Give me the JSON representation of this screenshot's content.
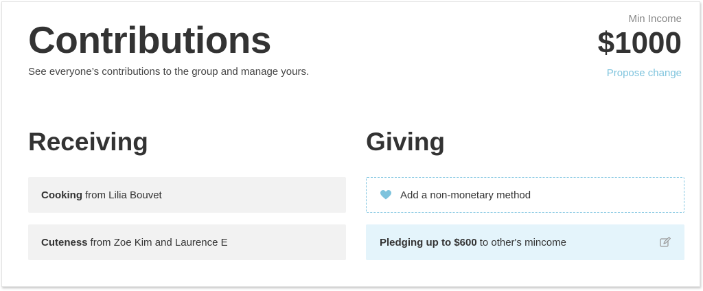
{
  "header": {
    "title": "Contributions",
    "subtitle": "See everyone’s contributions to the group and manage yours."
  },
  "min_income": {
    "label": "Min Income",
    "value": "$1000",
    "propose_link": "Propose change"
  },
  "receiving": {
    "title": "Receiving",
    "items": [
      {
        "what": "Cooking",
        "from_text": "from Lilia Bouvet"
      },
      {
        "what": "Cuteness",
        "from_text": "from Zoe Kim and Laurence E"
      }
    ]
  },
  "giving": {
    "title": "Giving",
    "add_method_label": "Add a non-monetary method",
    "add_method_icon": "heart-icon",
    "pledge": {
      "strong": "Pledging up to $600",
      "rest": "to other's mincome",
      "icon": "edit-icon"
    }
  },
  "colors": {
    "accent": "#7ec3dd",
    "pledge_bg": "#e4f4fb",
    "row_bg": "#f2f2f2",
    "heart": "#7ec3dd"
  }
}
